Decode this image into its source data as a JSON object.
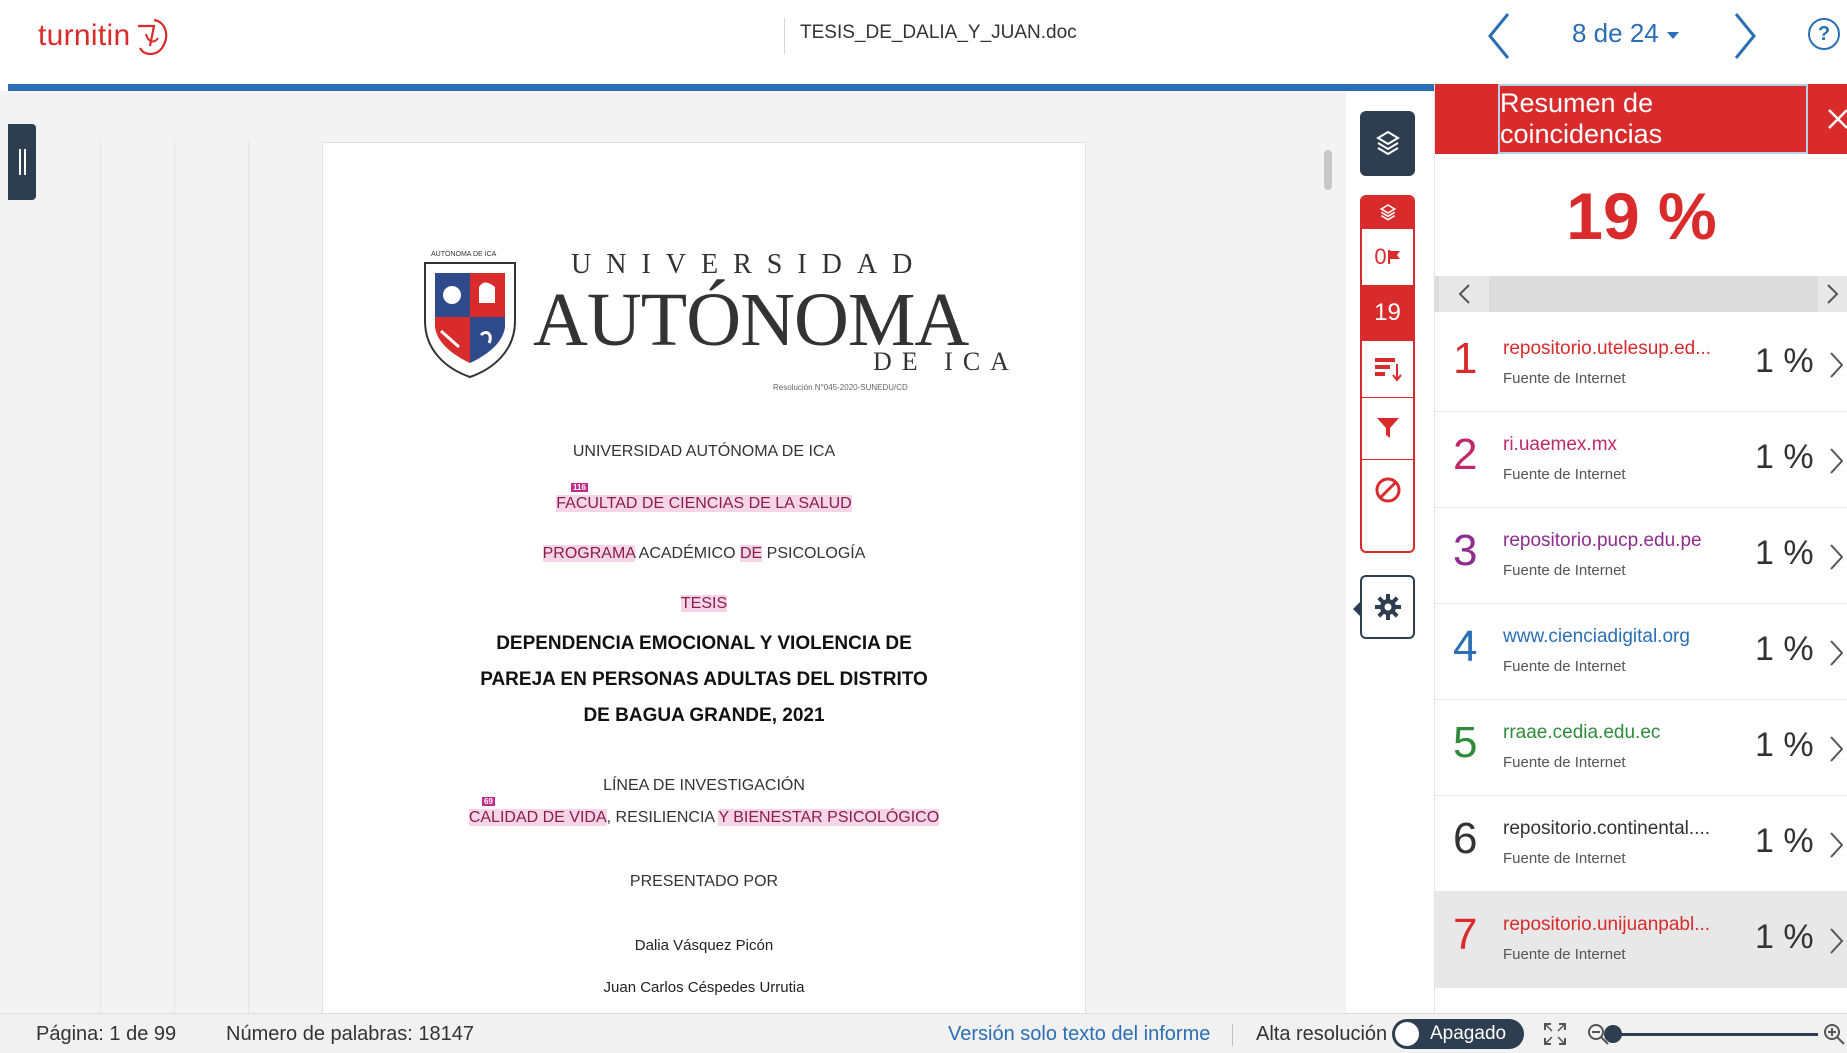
{
  "header": {
    "logo_text": "turnitin",
    "doc_title": "TESIS_DE_DALIA_Y_JUAN.doc",
    "page_selector": "8 de 24",
    "help_label": "?"
  },
  "document": {
    "crest_caption": "AUTÓNOMA DE ICA",
    "univ_word": "UNIVERSIDAD",
    "autonoma_word": "AUTÓNOMA",
    "de_ica": "DE ICA",
    "resolution": "Resolución N°045-2020-SUNEDU/CD",
    "university": "UNIVERSIDAD AUTÓNOMA DE ICA",
    "tag_116": "116",
    "faculty": "FACULTAD DE CIENCIAS DE LA SALUD",
    "program_a": "PROGRAMA",
    "program_b": " ACADÉMICO ",
    "program_c": "DE",
    "program_d": " PSICOLOGÍA",
    "tesis": "TESIS",
    "title_1": "DEPENDENCIA EMOCIONAL Y VIOLENCIA DE",
    "title_2": "PAREJA EN PERSONAS ADULTAS DEL DISTRITO",
    "title_3": "DE BAGUA GRANDE, 2021",
    "research_line": "LÍNEA DE INVESTIGACIÓN",
    "tag_69": "69",
    "line_a": "CALIDAD DE VIDA",
    "line_b": ", RESILIENCIA ",
    "line_c": "Y BIENESTAR PSICOLÓGICO",
    "presented_by": "PRESENTADO POR",
    "author_1": "Dalia Vásquez Picón",
    "author_2": "Juan Carlos Céspedes Urrutia"
  },
  "toolbar": {
    "flags_count": "0",
    "match_count": "19"
  },
  "panel": {
    "title": "Resumen de coincidencias",
    "overall_pct": "19 %",
    "sources": [
      {
        "num": "1",
        "name": "repositorio.utelesup.ed...",
        "type": "Fuente de Internet",
        "pct": "1 %",
        "color": "#d92b2b"
      },
      {
        "num": "2",
        "name": "ri.uaemex.mx",
        "type": "Fuente de Internet",
        "pct": "1 %",
        "color": "#c0286b"
      },
      {
        "num": "3",
        "name": "repositorio.pucp.edu.pe",
        "type": "Fuente de Internet",
        "pct": "1 %",
        "color": "#8e2c8f"
      },
      {
        "num": "4",
        "name": "www.cienciadigital.org",
        "type": "Fuente de Internet",
        "pct": "1 %",
        "color": "#2a6fb5"
      },
      {
        "num": "5",
        "name": "rraae.cedia.edu.ec",
        "type": "Fuente de Internet",
        "pct": "1 %",
        "color": "#2e8b3a"
      },
      {
        "num": "6",
        "name": "repositorio.continental....",
        "type": "Fuente de Internet",
        "pct": "1 %",
        "color": "#333333"
      },
      {
        "num": "7",
        "name": "repositorio.unijuanpabl...",
        "type": "Fuente de Internet",
        "pct": "1 %",
        "color": "#d92b2b"
      }
    ]
  },
  "status": {
    "page": "Página: 1 de 99",
    "words": "Número de palabras: 18147",
    "text_only": "Versión solo texto del informe",
    "hires": "Alta resolución",
    "toggle_state": "Apagado"
  },
  "colors": {
    "brand_red": "#d92b2b",
    "accent_blue": "#2a6fb5",
    "dark_navy": "#2d3e50"
  }
}
